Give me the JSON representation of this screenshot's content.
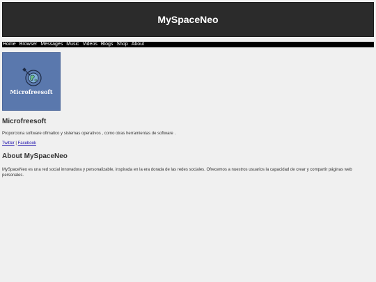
{
  "header": {
    "title": "MySpaceNeo"
  },
  "nav": {
    "items": [
      "Home",
      "Browser",
      "Messages",
      "Music",
      "Videos",
      "Blogs",
      "Shop",
      "About"
    ]
  },
  "profile": {
    "image_label": "Microfreesoft",
    "image_icon": "globe-satellite-icon",
    "name": "Microfreesoft",
    "description": "Proporciona software ofimatico y sistemas operativos , como otras herramientas de software .",
    "links": {
      "twitter": "Twitter",
      "separator": " | ",
      "facebook": "Facebook"
    }
  },
  "about": {
    "heading": "About MySpaceNeo",
    "text": "MySpaceNeo es una red social innovadora y personalizable, inspirada en la era dorada de las redes sociales. Ofrecemos a nuestros usuarios la capacidad de crear y compartir páginas web personales."
  },
  "colors": {
    "header_bg": "#2b2b2b",
    "nav_bg": "#000000",
    "page_bg": "#f0f0f0",
    "profile_image_bg": "#5a78ad",
    "link": "#1a0dab"
  }
}
